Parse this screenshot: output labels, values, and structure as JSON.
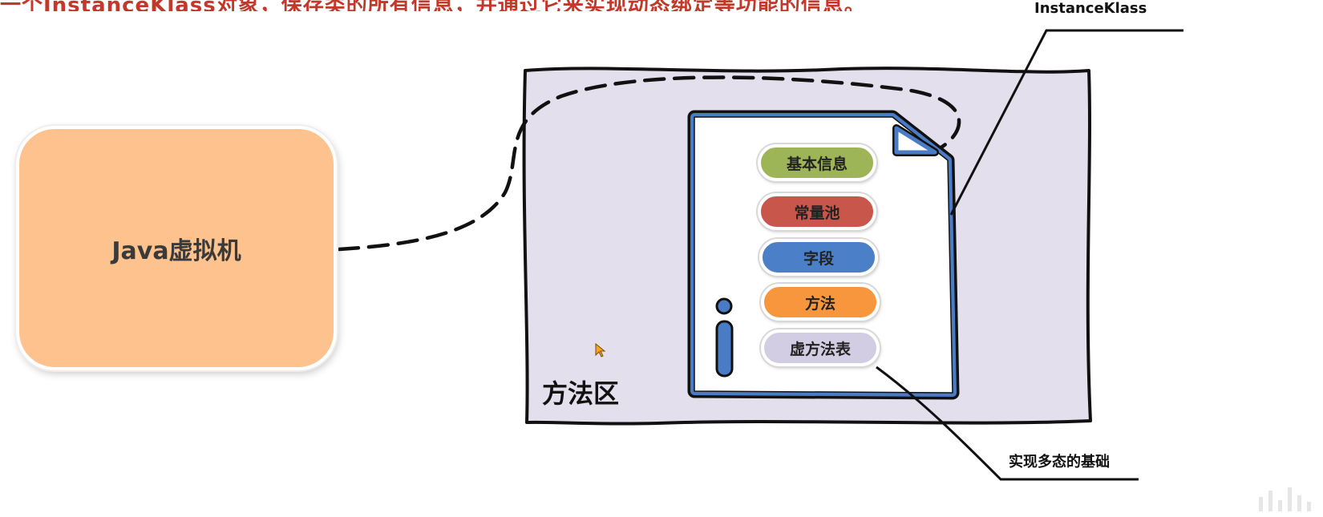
{
  "header": {
    "caption": "一个InstanceKlass对象，保存类的所有信息，并通过它来实现动态绑定等功能的信息。"
  },
  "jvm": {
    "label": "Java虚拟机"
  },
  "method_area": {
    "label": "方法区"
  },
  "instance_klass": {
    "label": "InstanceKlass",
    "sections": [
      {
        "label": "基本信息",
        "color": "#9db556"
      },
      {
        "label": "常量池",
        "color": "#c9564a"
      },
      {
        "label": "字段",
        "color": "#4b7fc8"
      },
      {
        "label": "方法",
        "color": "#f7963c"
      },
      {
        "label": "虚方法表",
        "color": "#d2cde2"
      }
    ]
  },
  "annotations": {
    "vtable_note": "实现多态的基础"
  },
  "colors": {
    "jvm_fill": "#fec28e",
    "method_area_fill": "#e3dfec",
    "document_outline": "#4a7cc6",
    "caption_text": "#c0392b"
  }
}
